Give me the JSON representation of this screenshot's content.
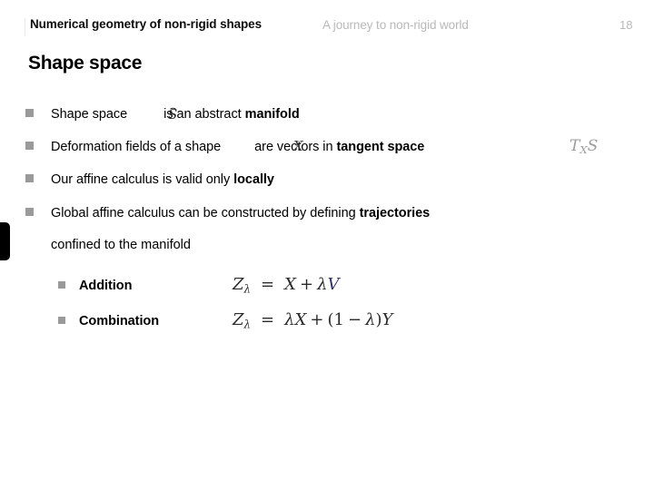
{
  "header": {
    "title": "Numerical geometry of non-rigid shapes",
    "subtitle": "A journey to non-rigid world",
    "page_number": "18",
    "rule_color": "#e8e8e8",
    "subtitle_color": "#b9b9b9"
  },
  "slide": {
    "title": "Shape space",
    "bullet_color": "#9a9a9a"
  },
  "bullets": [
    {
      "prefix": "Shape space",
      "math": "ᵊ",
      "suffix_plain": "  is an abstract ",
      "suffix_bold": "manifold"
    },
    {
      "prefix": "Deformation fields of a shape",
      "math": "X",
      "suffix_plain": "  are vectors in ",
      "suffix_bold": "tangent space",
      "trailing_math": "Tₓ𝒮"
    },
    {
      "prefix": "Our affine calculus is valid only ",
      "suffix_bold": "locally"
    },
    {
      "prefix": "Global affine calculus can be constructed by defining ",
      "suffix_bold": "trajectories",
      "continuation": "confined to the manifold"
    }
  ],
  "sub_bullets": [
    {
      "label": "Addition",
      "equation_text": "Zλ = X + λV",
      "lhs_var": "Z",
      "lhs_sub": "λ",
      "rhs": "X + λV"
    },
    {
      "label": "Combination",
      "equation_text": "Zλ = λX + (1 − λ)Y",
      "lhs_var": "Z",
      "lhs_sub": "λ",
      "rhs": "λX + (1 − λ)Y"
    }
  ],
  "math_symbols": {
    "shape_space": "𝒮",
    "shape_X": "X",
    "tangent_space": "T",
    "tangent_sub": "X",
    "tangent_S": "𝒮",
    "lambda": "λ",
    "equals": "=",
    "plus": "+",
    "minus": "−",
    "one": "1",
    "V": "V",
    "Y": "Y",
    "Z": "Z"
  },
  "edge_tab": {
    "glyph": "│",
    "color": "#000000"
  }
}
